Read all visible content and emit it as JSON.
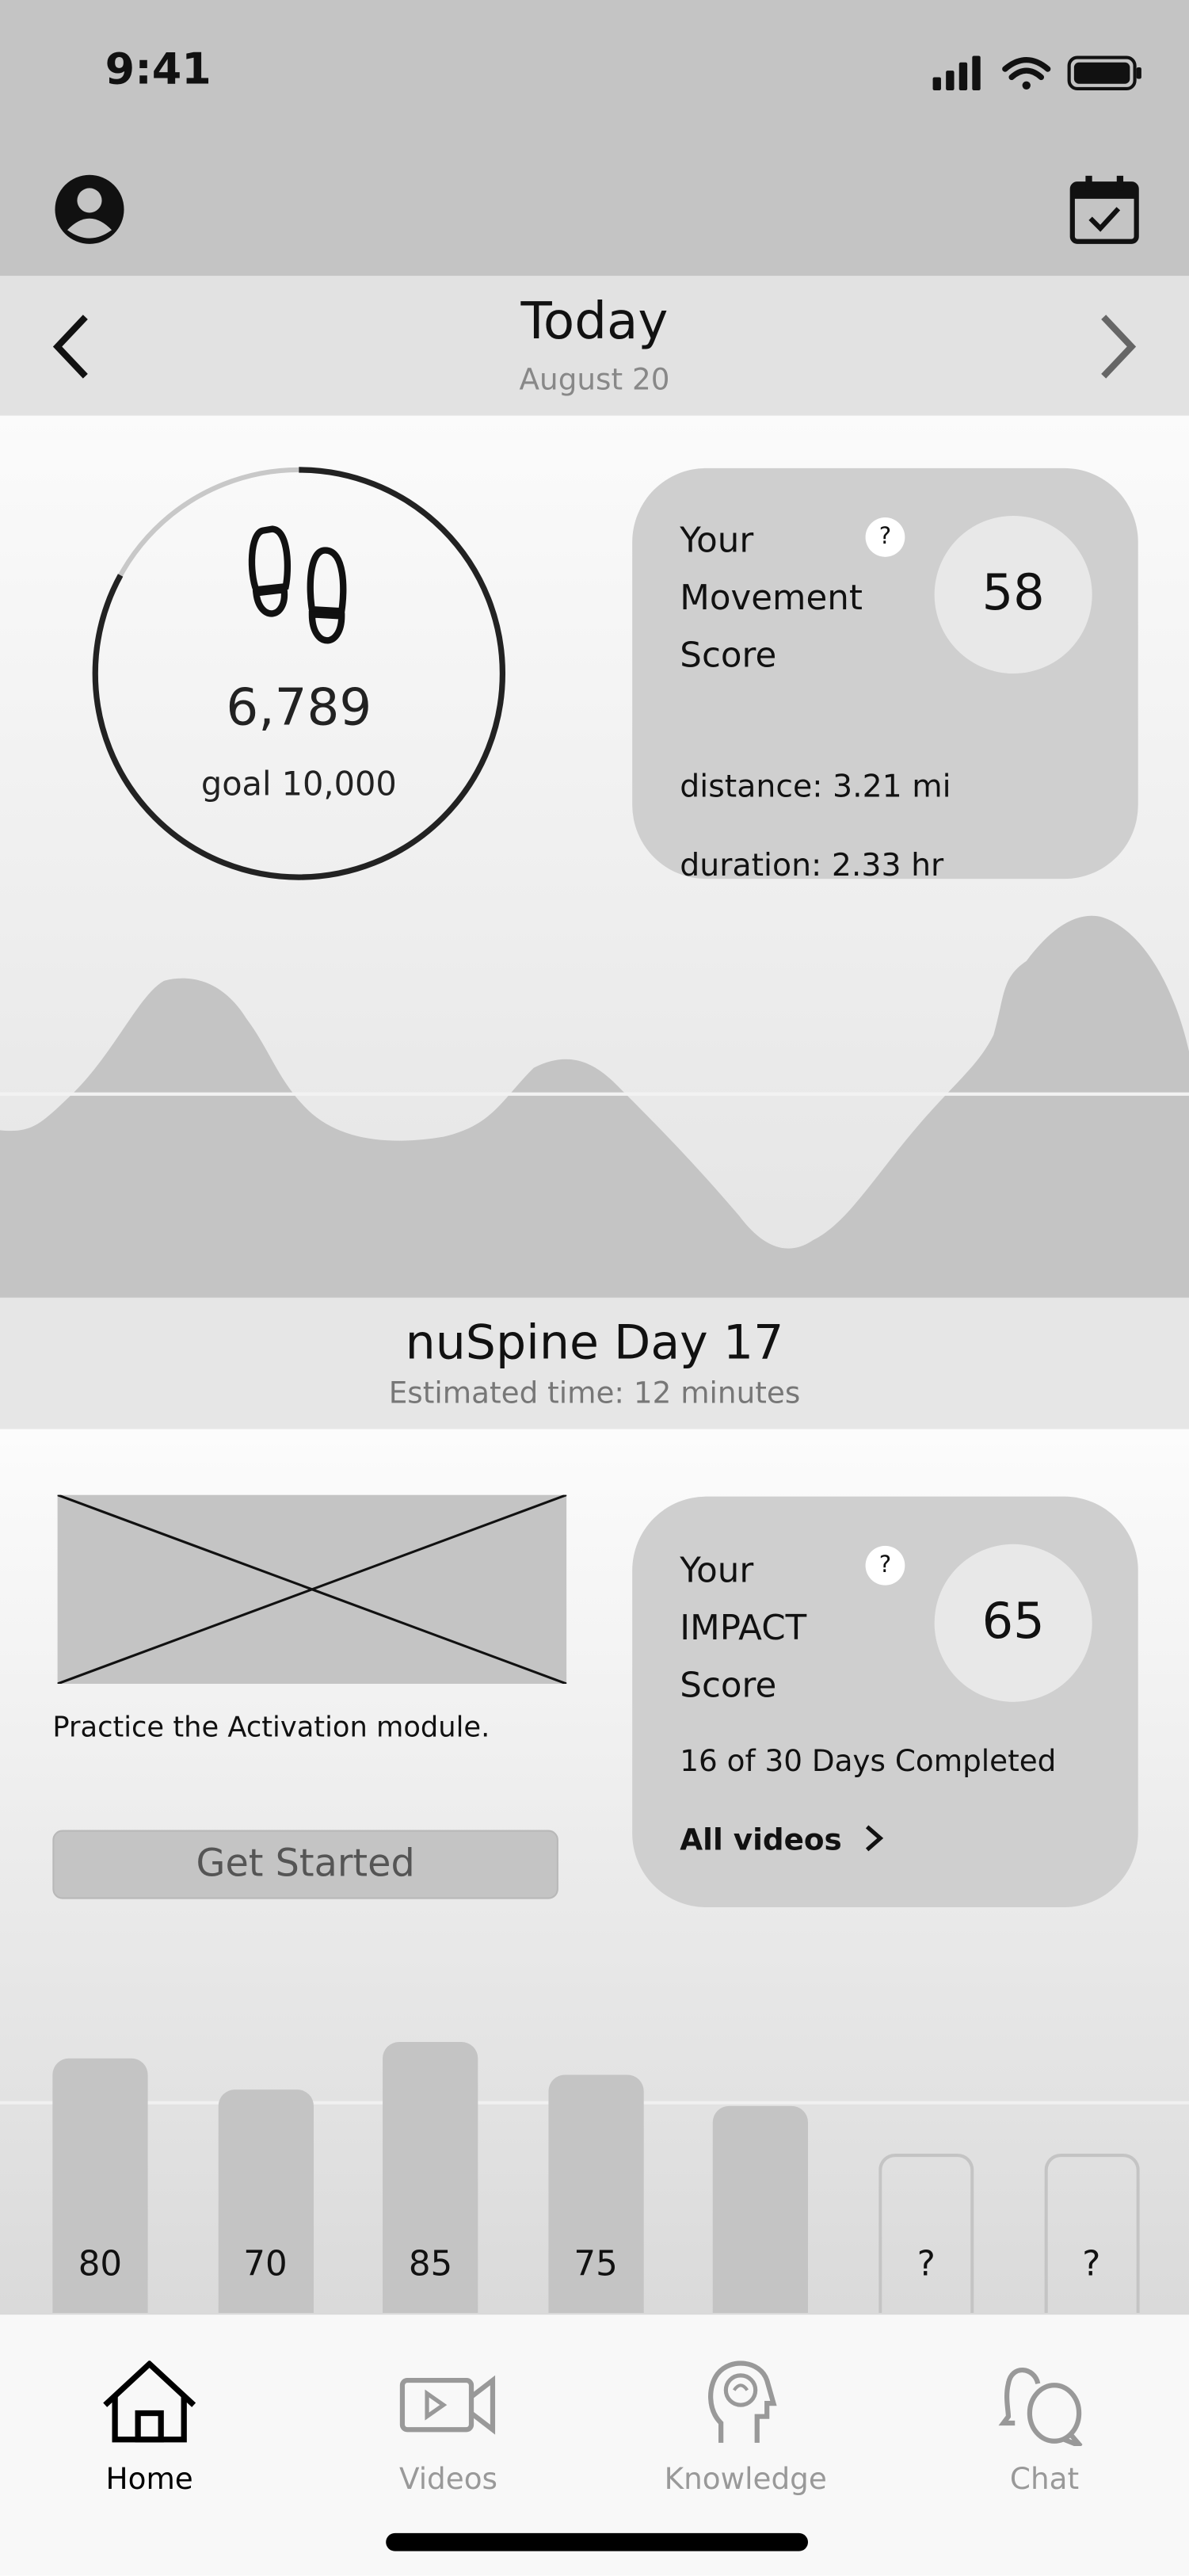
{
  "status_bar": {
    "time": "9:41",
    "icons": [
      "signal-icon",
      "wifi-icon",
      "battery-icon"
    ]
  },
  "header": {
    "left_icon": "profile-icon",
    "right_icon": "calendar-check-icon"
  },
  "date_nav": {
    "title": "Today",
    "subtitle": "August 20",
    "prev_icon": "chevron-left-icon",
    "next_icon": "chevron-right-icon"
  },
  "steps": {
    "count": "6,789",
    "goal": "goal 10,000",
    "icon": "footprints-icon",
    "ring_progress": 0.83
  },
  "movement": {
    "line1": "Your",
    "line2": "Movement",
    "line3": "Score",
    "help": "?",
    "score": "58",
    "distance": "distance: 3.21 mi",
    "duration": "duration: 2.33 hr"
  },
  "program": {
    "title": "nuSpine Day 17",
    "subtitle": "Estimated time: 12 minutes"
  },
  "lesson": {
    "description": "Practice the Activation module.",
    "button": "Get Started"
  },
  "impact": {
    "line1": "Your",
    "line2": "IMPACT",
    "line3": "Score",
    "help": "?",
    "score": "65",
    "progress": "16 of 30 Days Completed",
    "link": "All videos"
  },
  "history_bars": [
    {
      "label": "80",
      "value": 80,
      "filled": true
    },
    {
      "label": "70",
      "value": 70,
      "filled": true
    },
    {
      "label": "85",
      "value": 85,
      "filled": true
    },
    {
      "label": "75",
      "value": 75,
      "filled": true
    },
    {
      "label": "",
      "value": 65,
      "filled": true
    },
    {
      "label": "?",
      "value": 50,
      "filled": false
    },
    {
      "label": "?",
      "value": 50,
      "filled": false
    }
  ],
  "tabs": [
    {
      "label": "Home",
      "icon": "home-icon",
      "active": true
    },
    {
      "label": "Videos",
      "icon": "video-camera-icon",
      "active": false
    },
    {
      "label": "Knowledge",
      "icon": "brain-head-icon",
      "active": false
    },
    {
      "label": "Chat",
      "icon": "chat-bubbles-icon",
      "active": false
    }
  ],
  "colors": {
    "header": "#c4c4c4",
    "card": "#cfcfcf",
    "active_tab": "#000000",
    "inactive_tab": "#999999"
  }
}
